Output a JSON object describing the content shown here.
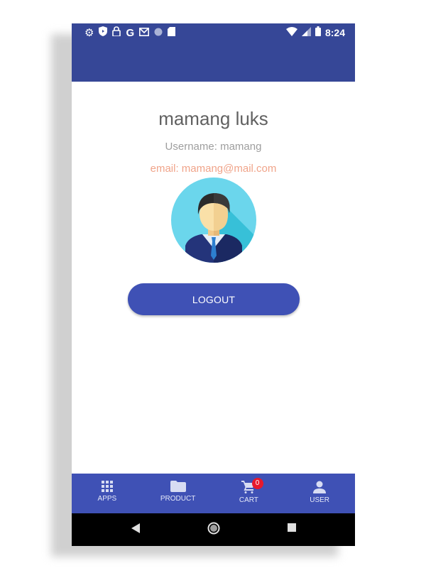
{
  "status_bar": {
    "left_icons": [
      "settings-icon",
      "shield-icon",
      "lock-icon",
      "google-icon",
      "gmail-icon",
      "circle-icon",
      "sd-card-icon"
    ],
    "google_letter": "G",
    "right_icons": [
      "wifi-icon",
      "signal-icon",
      "battery-icon"
    ],
    "time": "8:24",
    "color": "#364797"
  },
  "profile": {
    "name": "mamang luks",
    "username": "Username: mamang",
    "email": "email: mamang@mail.com",
    "avatar_icon": "businessman-avatar-icon"
  },
  "logout_label": "LOGOUT",
  "bottom_nav": {
    "color": "#3f51b5",
    "items": [
      {
        "label": "APPS",
        "icon": "grid-icon"
      },
      {
        "label": "PRODUCT",
        "icon": "folder-icon"
      },
      {
        "label": "CART",
        "icon": "cart-icon",
        "badge": "0"
      },
      {
        "label": "USER",
        "icon": "person-icon"
      }
    ]
  },
  "system_nav": [
    "back-icon",
    "home-icon",
    "recents-icon"
  ]
}
